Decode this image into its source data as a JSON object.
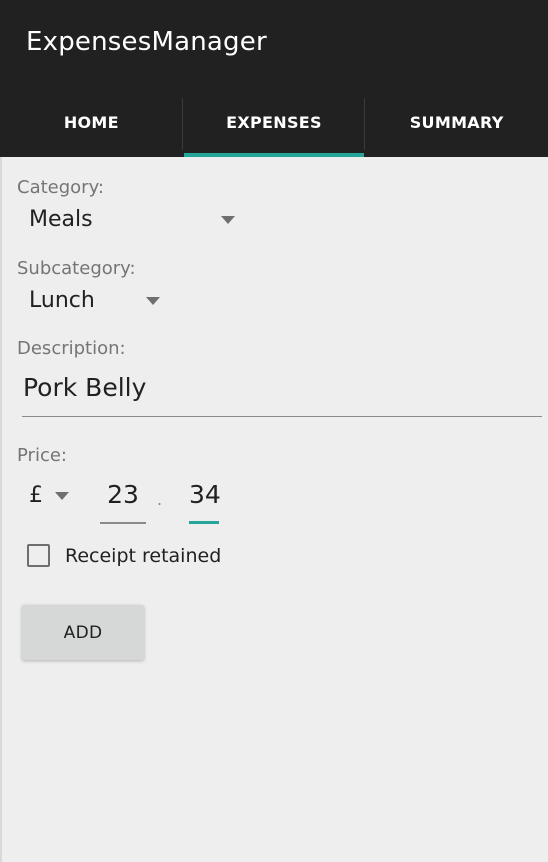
{
  "app": {
    "title": "ExpensesManager"
  },
  "tabs": [
    {
      "label": "HOME",
      "active": false
    },
    {
      "label": "EXPENSES",
      "active": true
    },
    {
      "label": "SUMMARY",
      "active": false
    }
  ],
  "form": {
    "category": {
      "label": "Category:",
      "value": "Meals"
    },
    "subcategory": {
      "label": "Subcategory:",
      "value": "Lunch"
    },
    "description": {
      "label": "Description:",
      "value": "Pork Belly"
    },
    "price": {
      "label": "Price:",
      "currency": "£",
      "major": "23",
      "separator": ".",
      "minor": "34"
    },
    "receipt": {
      "label": "Receipt retained",
      "checked": false
    },
    "add_button_label": "ADD"
  },
  "colors": {
    "app_bar": "#212121",
    "accent": "#26a69a",
    "background": "#eeeeee",
    "button": "#d6d7d7"
  },
  "icons": {
    "dropdown": "dropdown-arrow-icon",
    "checkbox": "checkbox-unchecked-icon"
  }
}
